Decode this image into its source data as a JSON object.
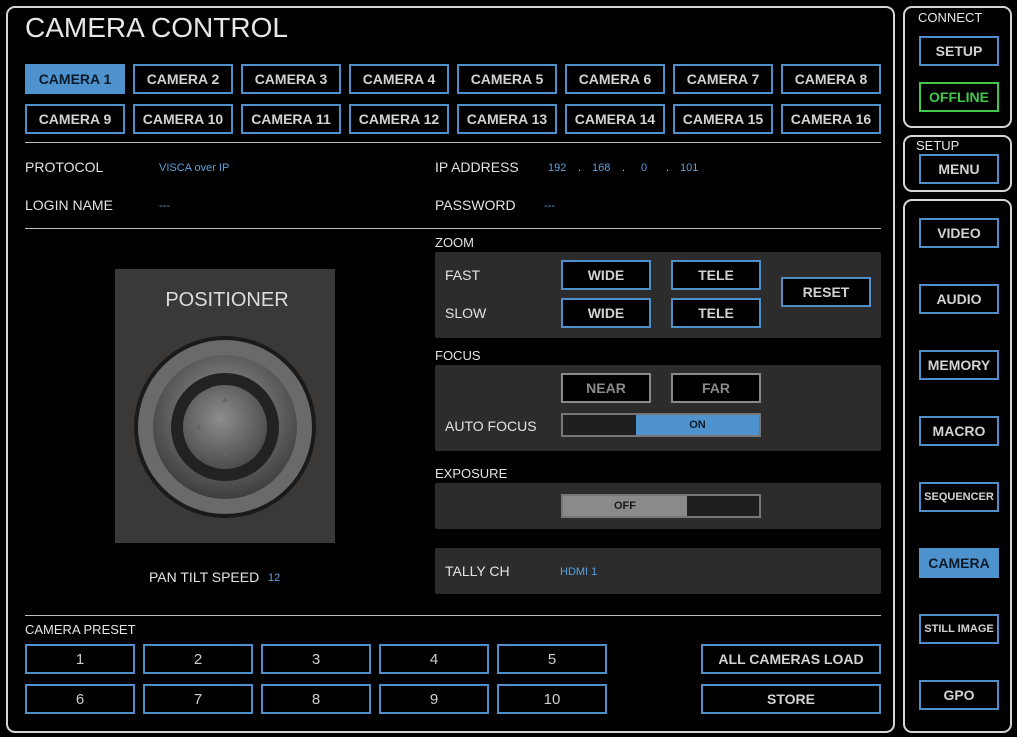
{
  "header": {
    "title": "CAMERA CONTROL"
  },
  "cameras": [
    "CAMERA 1",
    "CAMERA 2",
    "CAMERA 3",
    "CAMERA 4",
    "CAMERA 5",
    "CAMERA 6",
    "CAMERA 7",
    "CAMERA 8",
    "CAMERA 9",
    "CAMERA 10",
    "CAMERA 11",
    "CAMERA 12",
    "CAMERA 13",
    "CAMERA 14",
    "CAMERA 15",
    "CAMERA 16"
  ],
  "selected_camera": "CAMERA 1",
  "info": {
    "protocol_label": "PROTOCOL",
    "protocol_value": "VISCA over IP",
    "login_label": "LOGIN NAME",
    "login_value": "---",
    "ip_label": "IP ADDRESS",
    "ip": [
      "192",
      "168",
      "0",
      "101"
    ],
    "ip_dot": ".",
    "password_label": "PASSWORD",
    "password_value": "---"
  },
  "positioner": {
    "title": "POSITIONER",
    "speed_label": "PAN TILT SPEED",
    "speed_value": "12"
  },
  "zoom": {
    "title": "ZOOM",
    "fast_label": "FAST",
    "slow_label": "SLOW",
    "wide": "WIDE",
    "tele": "TELE",
    "reset": "RESET"
  },
  "focus": {
    "title": "FOCUS",
    "near": "NEAR",
    "far": "FAR",
    "auto_label": "AUTO FOCUS",
    "auto_state": "ON"
  },
  "exposure": {
    "title": "EXPOSURE",
    "state": "OFF"
  },
  "tally": {
    "label": "TALLY CH",
    "value": "HDMI 1"
  },
  "preset": {
    "title": "CAMERA PRESET",
    "numbers": [
      "1",
      "2",
      "3",
      "4",
      "5",
      "6",
      "7",
      "8",
      "9",
      "10"
    ],
    "all_load": "ALL CAMERAS LOAD",
    "store": "STORE"
  },
  "sidebar": {
    "connect_title": "CONNECT",
    "setup_button": "SETUP",
    "status": "OFFLINE",
    "setup_title": "SETUP",
    "menu_button": "MENU",
    "nav": [
      "VIDEO",
      "AUDIO",
      "MEMORY",
      "MACRO",
      "SEQUENCER",
      "CAMERA",
      "STILL IMAGE",
      "GPO"
    ],
    "nav_active": "CAMERA"
  },
  "colors": {
    "accent": "#4e93cd",
    "status_offline": "#3fc84a",
    "value_text": "#5aa0dc"
  }
}
